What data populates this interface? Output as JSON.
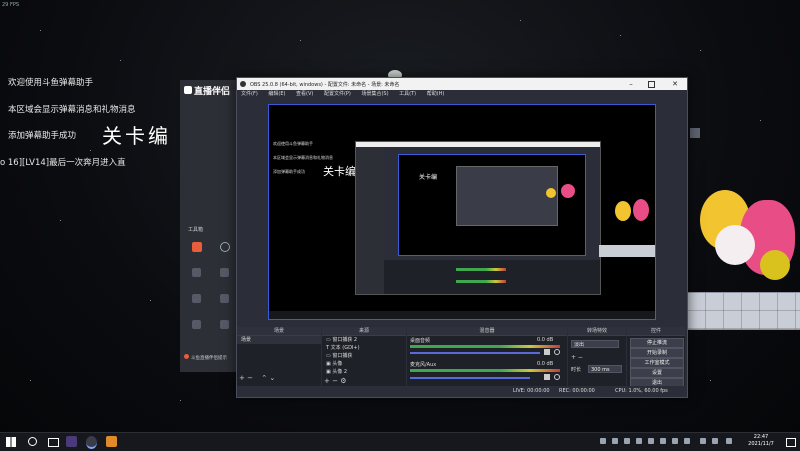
{
  "fps_overlay": "29 FPS",
  "desktop": {
    "danmaku_lines": [
      "欢迎使用斗鱼弹幕助手",
      "本区域会显示弹幕消息和礼物消息",
      "添加弹幕助手成功",
      "o 16][LV14]最后一次奔月进入直"
    ],
    "stage_title": "关卡编"
  },
  "assistant": {
    "logo": "直播伴侣",
    "toolbox_label": "工具箱",
    "footer_text": "斗鱼直播伴侣提示"
  },
  "obs": {
    "title": "OBS 25.0.8 (64-bit, windows) - 配置文件: 未命名 - 场景: 未命名",
    "menu": [
      "文件(F)",
      "编辑(E)",
      "查看(V)",
      "配置文件(P)",
      "场景集合(S)",
      "工具(T)",
      "帮助(H)"
    ],
    "docks": {
      "scenes": "场景",
      "sources": "来源",
      "mixer": "混音器",
      "transitions": "转场特效",
      "controls": "控件"
    },
    "scenes": [
      "场景"
    ],
    "sources": [
      "窗口捕获 2",
      "文本 (GDI+)",
      "窗口捕获",
      "头像",
      "头像 2"
    ],
    "mixer": [
      {
        "name": "桌面音频",
        "db": "0.0 dB"
      },
      {
        "name": "麦克风/Aux",
        "db": "0.0 dB"
      }
    ],
    "transition": {
      "type": "淡出",
      "duration_label": "时长",
      "duration": "300 ms"
    },
    "controls": [
      "停止推流",
      "开始录制",
      "工作室模式",
      "设置",
      "退出"
    ],
    "status": {
      "live": "LIVE: 00:00:00",
      "rec": "REC: 00:00:00",
      "cpu": "CPU: 1.0%, 60.00 fps"
    }
  },
  "taskbar": {
    "clock_time": "22:47",
    "clock_date": "2021/11/7"
  },
  "colors": {
    "obs_bg": "#2b2e38",
    "preview_border": "#3a5bd8",
    "assistant_accent": "#e85d3a"
  }
}
